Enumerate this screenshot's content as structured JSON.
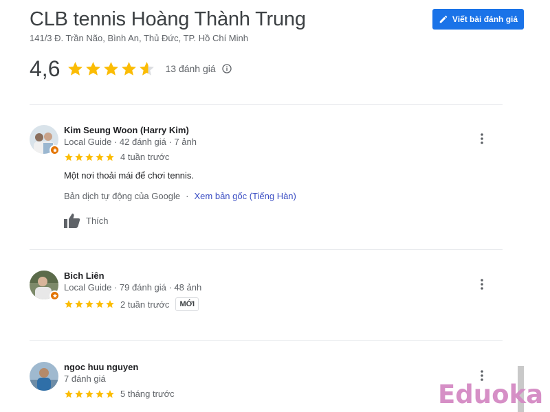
{
  "place": {
    "title": "CLB tennis Hoàng Thành Trung",
    "address": "141/3 Đ. Trần Não, Bình An, Thủ Đức, TP. Hồ Chí Minh",
    "write_review_label": "Viết bài đánh giá",
    "rating_value": "4,6",
    "rating_stars": 4.6,
    "review_count_label": "13 đánh giá"
  },
  "colors": {
    "accent": "#1a73e8",
    "star": "#fbbc04",
    "star_empty": "#dadce0",
    "guide_badge": "#e37400",
    "link": "#3c4fc4"
  },
  "icons": [
    "pencil-icon",
    "star-icon",
    "info-icon",
    "local-guide-icon",
    "thumb-up-icon",
    "more-vert-icon"
  ],
  "reviews": [
    {
      "author": "Kim Seung Woon (Harry Kim)",
      "meta": "Local Guide · 42 đánh giá · 7 ảnh",
      "stars": 5,
      "time": "4 tuần trước",
      "text": "Một nơi thoải mái để chơi tennis.",
      "translation_note": "Bản dịch tự động của Google",
      "translation_separator": "·",
      "translation_link": "Xem bản gốc (Tiếng Hàn)",
      "like_label": "Thích",
      "local_guide": true
    },
    {
      "author": "Bich Liên",
      "meta": "Local Guide · 79 đánh giá · 48 ảnh",
      "stars": 5,
      "time": "2 tuần trước",
      "badge": "MỚI",
      "local_guide": true
    },
    {
      "author": "ngoc huu nguyen",
      "meta": "7 đánh giá",
      "stars": 5,
      "time": "5 tháng trước",
      "local_guide": false
    }
  ],
  "watermark": "Eduoka"
}
